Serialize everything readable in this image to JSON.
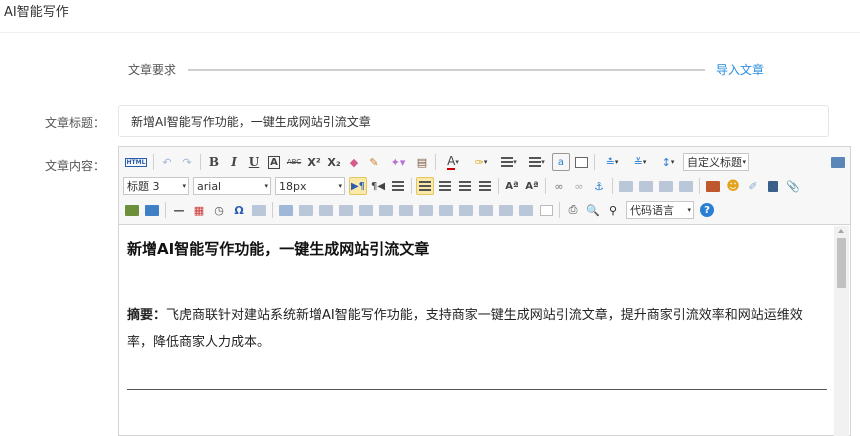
{
  "page": {
    "title": "AI智能写作"
  },
  "steps": {
    "step1": "文章要求",
    "step2": "导入文章"
  },
  "form": {
    "title_label": "文章标题：",
    "title_value": "新增AI智能写作功能，一键生成网站引流文章",
    "content_label": "文章内容："
  },
  "toolbar": {
    "row1": {
      "html_label": "HTML",
      "font_color": "A",
      "custom_heading": "自定义标题"
    },
    "row2": {
      "paragraph_format": "标题 3",
      "font_family": "arial",
      "font_size": "18px"
    },
    "row3": {
      "code_language": "代码语言"
    },
    "colors": {
      "active_bg": "#fbe9a8",
      "accent": "#2b8cde"
    }
  },
  "document": {
    "heading": "新增AI智能写作功能，一键生成网站引流文章",
    "summary_label": "摘要：",
    "summary_text": "飞虎商联针对建站系统新增AI智能写作功能，支持商家一键生成网站引流文章，提升商家引流效率和网站运维效率，降低商家人力成本。"
  }
}
